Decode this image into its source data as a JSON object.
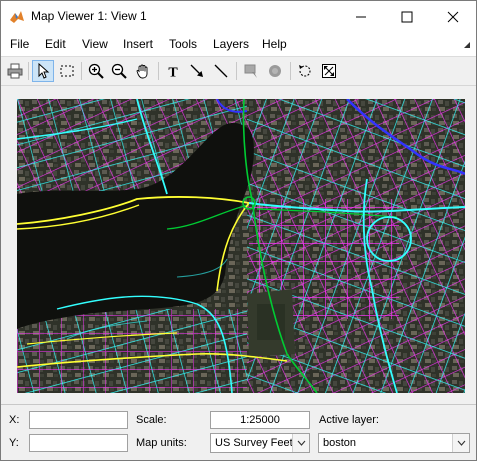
{
  "window": {
    "title": "Map Viewer 1: View 1",
    "controls": {
      "minimize": "minimize-icon",
      "maximize": "maximize-icon",
      "close": "close-icon"
    }
  },
  "menu": {
    "items": [
      "File",
      "Edit",
      "View",
      "Insert",
      "Tools",
      "Layers",
      "Help"
    ]
  },
  "toolbar": {
    "buttons": [
      "print-icon",
      "select-arrow-icon",
      "rectangle-select-icon",
      "zoom-in-icon",
      "zoom-out-icon",
      "pan-hand-icon",
      "text-tool-icon",
      "arrow-tool-icon",
      "line-tool-icon",
      "datatip-icon",
      "info-icon",
      "rotate-icon",
      "fit-view-icon"
    ],
    "active": "select-arrow-icon"
  },
  "status": {
    "x_label": "X:",
    "y_label": "Y:",
    "x_value": "",
    "y_value": "",
    "scale_label": "Scale:",
    "scale_value": "1:25000",
    "map_units_label": "Map units:",
    "map_units_value": "US Survey Feet",
    "active_layer_label": "Active layer:",
    "active_layer_value": "boston"
  },
  "map": {
    "road_colors": {
      "major": "#ffff33",
      "arterial": "#33ffff",
      "local": "#ff33ff",
      "primary": "#00cc33",
      "highway": "#3333ff"
    }
  }
}
